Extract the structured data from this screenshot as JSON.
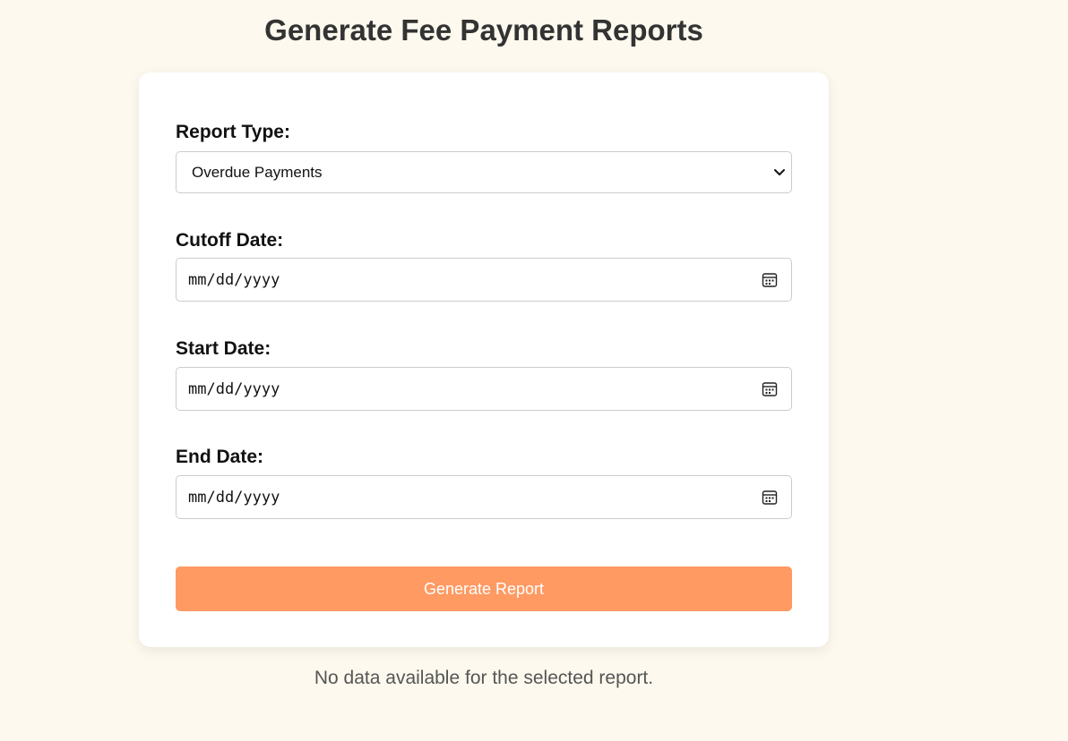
{
  "page": {
    "title": "Generate Fee Payment Reports",
    "background_color": "#fdf9ee"
  },
  "form": {
    "report_type": {
      "label": "Report Type:",
      "selected": "Overdue Payments"
    },
    "cutoff_date": {
      "label": "Cutoff Date:",
      "placeholder": "mm/dd/yyyy",
      "icon": "calendar-icon"
    },
    "start_date": {
      "label": "Start Date:",
      "placeholder": "mm/dd/yyyy",
      "icon": "calendar-icon"
    },
    "end_date": {
      "label": "End Date:",
      "placeholder": "mm/dd/yyyy",
      "icon": "calendar-icon"
    },
    "submit_label": "Generate Report",
    "accent_color": "#ff9a63"
  },
  "status": {
    "message": "No data available for the selected report."
  }
}
